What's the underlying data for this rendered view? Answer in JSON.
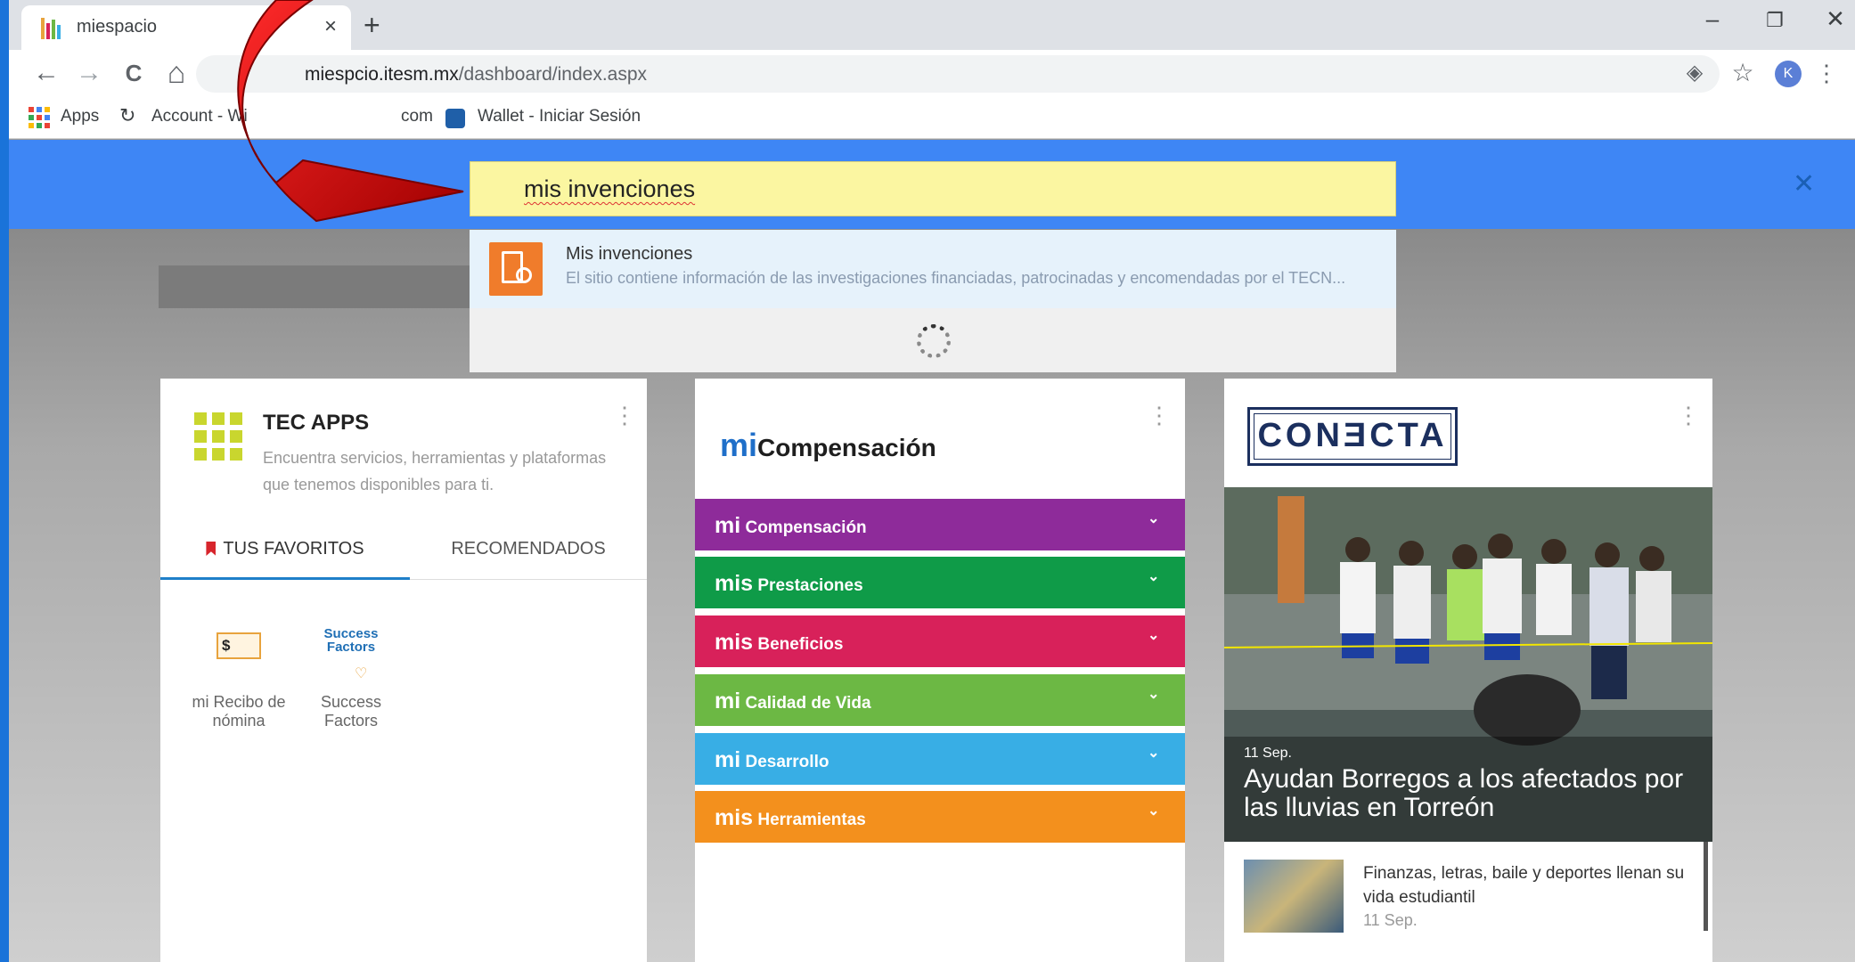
{
  "browser": {
    "tab_title": "miespacio",
    "tab_close": "×",
    "new_tab": "+",
    "minimize": "–",
    "restore": "❐",
    "close": "✕",
    "back": "←",
    "forward": "→",
    "reload": "C",
    "home": "⌂",
    "url_host": "miesp",
    "url_host_rest": "cio.itesm.mx",
    "url_path": "/dashboard/index.aspx",
    "location_icon": "◈",
    "star": "☆",
    "profile_initial": "K",
    "menu": "⋮",
    "bookmarks": {
      "apps": "Apps",
      "account": "Account - Wi",
      "com": "com",
      "wallet": "Wallet - Iniciar Sesión"
    }
  },
  "search": {
    "query": "mis invenciones",
    "close": "✕",
    "result_title": "Mis invenciones",
    "result_desc": "El sitio contiene información de las investigaciones financiadas, patrocinadas y encomendadas por el TECN..."
  },
  "tec_apps": {
    "title": "TEC APPS",
    "subtitle": "Encuentra servicios, herramientas y plataformas que tenemos disponibles para ti.",
    "tab_favorites": "TUS FAVORITOS",
    "tab_recommended": "RECOMENDADOS",
    "favorites": [
      {
        "label": "mi Recibo de nómina",
        "icon": "$"
      },
      {
        "label": "Success Factors",
        "icon": "Success Factors"
      }
    ]
  },
  "micompensacion": {
    "logo_prefix": "mi",
    "logo_text": "Compensación",
    "items": [
      {
        "prefix": "mi",
        "label": "Compensación",
        "color": "#8e2b9a"
      },
      {
        "prefix": "mis",
        "label": "Prestaciones",
        "color": "#0f9b48"
      },
      {
        "prefix": "mis",
        "label": "Beneficios",
        "color": "#d8215a"
      },
      {
        "prefix": "mi",
        "label": "Calidad de Vida",
        "color": "#6cb844"
      },
      {
        "prefix": "mi",
        "label": "Desarrollo",
        "color": "#38aee5"
      },
      {
        "prefix": "mis",
        "label": "Herramientas",
        "color": "#f3901d"
      }
    ]
  },
  "conecta": {
    "logo": "CONƎCTA",
    "featured_date": "11 Sep.",
    "featured_title": "Ayudan Borregos a los afectados por las lluvias en Torreón",
    "news": [
      {
        "title": "Finanzas, letras, baile y deportes llenan su vida estudiantil",
        "date": "11 Sep."
      }
    ]
  },
  "colors": {
    "banner": "#3e86f5",
    "search_bg": "#fbf6a1",
    "arrow": "#d40000"
  }
}
